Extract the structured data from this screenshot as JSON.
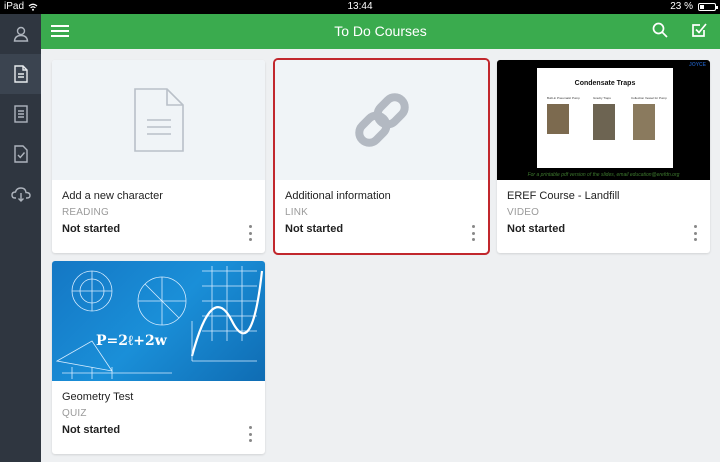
{
  "status_bar": {
    "carrier": "iPad",
    "time": "13:44",
    "battery": "23 %",
    "battery_level": 0.23
  },
  "header": {
    "title": "To Do Courses"
  },
  "sidebar": {
    "items": [
      {
        "icon": "user-icon"
      },
      {
        "icon": "document-icon",
        "active": true
      },
      {
        "icon": "list-document-icon"
      },
      {
        "icon": "checked-document-icon"
      },
      {
        "icon": "cloud-download-icon"
      }
    ]
  },
  "courses": [
    {
      "name": "Add a new character",
      "type": "READING",
      "status": "Not started",
      "thumb": "document-icon"
    },
    {
      "name": "Additional information",
      "type": "LINK",
      "status": "Not started",
      "thumb": "link-icon",
      "selected": true
    },
    {
      "name": "EREF Course - Landfill",
      "type": "VIDEO",
      "status": "Not started",
      "thumb": "slide-image"
    },
    {
      "name": "Geometry Test",
      "type": "QUIZ",
      "status": "Not started",
      "thumb": "math-image"
    }
  ],
  "slide": {
    "title": "Condensate Traps",
    "labels": [
      "Built-in Pneumatic Pump",
      "Gravity Traps",
      "Collection Vessel for Pump"
    ],
    "caption": "For a printable pdf version of the slides, email education@erefdn.org",
    "logo": "JOYCE"
  },
  "math": {
    "formula": "P=2ℓ+2w"
  },
  "colors": {
    "accent": "#3aab4e",
    "sidebar": "#2f3640",
    "selection": "#c1272d"
  }
}
